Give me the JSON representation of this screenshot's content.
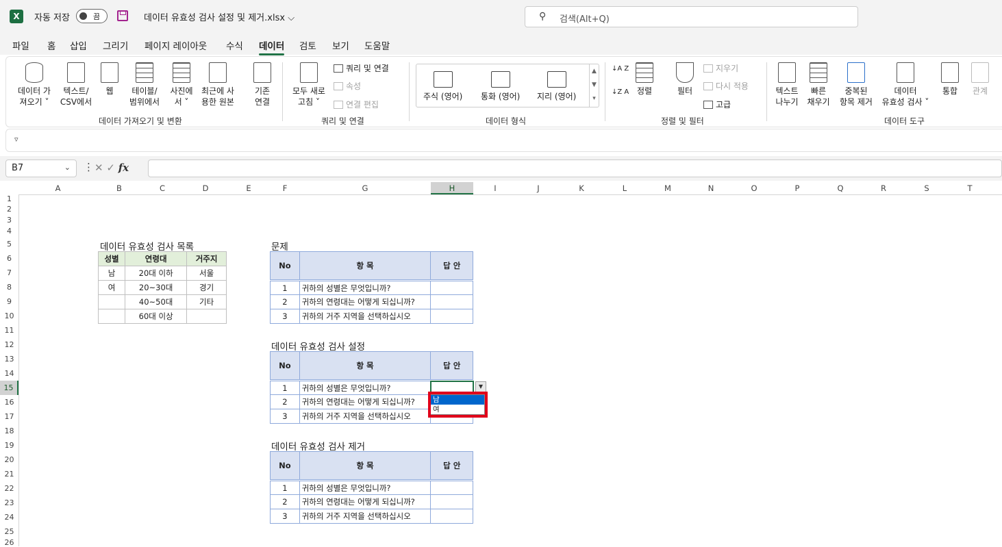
{
  "titlebar": {
    "logo": "X",
    "autosave_label": "자동 저장",
    "autosave_state": "끔",
    "filename": "데이터 유효성 검사 설정 및 제거.xlsx",
    "filename_chevron": "⌵",
    "search_placeholder": "검색(Alt+Q)"
  },
  "menu": [
    "파일",
    "홈",
    "삽입",
    "그리기",
    "페이지 레이아웃",
    "수식",
    "데이터",
    "검토",
    "보기",
    "도움말"
  ],
  "active_menu": "데이터",
  "ribbon": {
    "get_data": {
      "buttons": [
        {
          "l1": "데이터 가",
          "l2": "져오기 ˅",
          "icon": "database-icon"
        },
        {
          "l1": "텍스트/",
          "l2": "CSV에서",
          "icon": "text-file-icon"
        },
        {
          "l1": "웹",
          "l2": "",
          "icon": "web-icon"
        },
        {
          "l1": "테이블/",
          "l2": "범위에서",
          "icon": "table-icon"
        },
        {
          "l1": "사진에",
          "l2": "서 ˅",
          "icon": "picture-icon"
        },
        {
          "l1": "최근에 사",
          "l2": "용한 원본",
          "icon": "recent-sources-icon"
        },
        {
          "l1": "기존",
          "l2": "연결",
          "icon": "existing-connections-icon"
        }
      ],
      "label": "데이터 가져오기 및 변환"
    },
    "queries": {
      "refresh_l1": "모두 새로",
      "refresh_l2": "고침 ˅",
      "queries_connections": "쿼리 및 연결",
      "properties": "속성",
      "edit_links": "연결 편집",
      "label": "쿼리 및 연결"
    },
    "data_types": {
      "items": [
        "주식 (영어)",
        "통화 (영어)",
        "지리 (영어)"
      ],
      "label": "데이터 형식"
    },
    "sort_filter": {
      "sort_az": "↓A Z",
      "sort_za": "↓Z A",
      "sort": "정렬",
      "filter": "필터",
      "clear": "지우기",
      "reapply": "다시 적용",
      "advanced": "고급",
      "label": "정렬 및 필터"
    },
    "data_tools": {
      "text_to_columns_l1": "텍스트",
      "text_to_columns_l2": "나누기",
      "flash_fill_l1": "빠른",
      "flash_fill_l2": "채우기",
      "remove_dup_l1": "중복된",
      "remove_dup_l2": "항목 제거",
      "validation_l1": "데이터",
      "validation_l2": "유효성 검사 ˅",
      "consolidate": "통합",
      "relationships": "관계",
      "label": "데이터 도구"
    }
  },
  "qat_symbol": "▿",
  "formula_bar": {
    "name_box": "B7",
    "value": ""
  },
  "columns": [
    "A",
    "B",
    "C",
    "D",
    "E",
    "F",
    "G",
    "H",
    "I",
    "J",
    "K",
    "L",
    "M",
    "N",
    "O",
    "P",
    "Q",
    "R",
    "S",
    "T"
  ],
  "selected_column": "H",
  "rows": [
    "1",
    "2",
    "3",
    "4",
    "5",
    "6",
    "7",
    "8",
    "9",
    "10",
    "11",
    "12",
    "13",
    "14",
    "15",
    "16",
    "17",
    "18",
    "19",
    "20",
    "21",
    "22",
    "23",
    "24",
    "25",
    "26"
  ],
  "selected_row": "15",
  "list_table": {
    "title": "데이터 유효성 검사 목록",
    "headers": [
      "성별",
      "연령대",
      "거주지"
    ],
    "rows": [
      [
        "남",
        "20대 이하",
        "서울"
      ],
      [
        "여",
        "20~30대",
        "경기"
      ],
      [
        "",
        "40~50대",
        "기타"
      ],
      [
        "",
        "60대 이상",
        ""
      ]
    ]
  },
  "question_header": {
    "no": "No",
    "item": "항 목",
    "answer": "답 안"
  },
  "questions": [
    {
      "no": "1",
      "text": "귀하의 성별은 무엇입니까?"
    },
    {
      "no": "2",
      "text": "귀하의 연령대는 어떻게 되십니까?"
    },
    {
      "no": "3",
      "text": "귀하의 거주 지역을 선택하십시오"
    }
  ],
  "section_titles": {
    "problem": "문제",
    "setup": "데이터 유효성 검사 설정",
    "remove": "데이터 유효성 검사 제거"
  },
  "dropdown": {
    "options": [
      "남",
      "여"
    ],
    "highlighted": "남"
  }
}
